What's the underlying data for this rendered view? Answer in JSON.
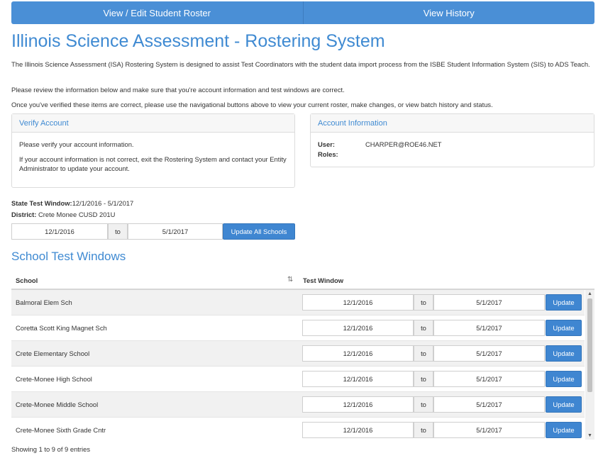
{
  "nav": {
    "roster_label": "View / Edit Student Roster",
    "history_label": "View History"
  },
  "page": {
    "title": "Illinois Science Assessment - Rostering System",
    "intro1": "The Illinois Science Assessment (ISA) Rostering System is designed to assist Test Coordinators with the student data import process from the ISBE Student Information System (SIS) to ADS Teach.",
    "intro2": "Please review the information below and make sure that you're account information and test windows are correct.",
    "intro3": "Once you've verified these items are correct, please use the navigational buttons above to view your current roster, make changes, or view batch history and status."
  },
  "verify": {
    "title": "Verify Account",
    "line1": "Please verify your account information.",
    "line2": "If your account information is not correct, exit the Rostering System and contact your Entity Administrator to update your account."
  },
  "account": {
    "title": "Account Information",
    "user_label": "User:",
    "user_value": "CHARPER@ROE46.NET",
    "roles_label": "Roles:",
    "roles_value": ""
  },
  "state_window": {
    "label": "State Test Window:",
    "value": "12/1/2016 - 5/1/2017"
  },
  "district": {
    "label": "District:",
    "value": "Crete Monee CUSD 201U"
  },
  "district_window": {
    "start": "12/1/2016",
    "to": "to",
    "end": "5/1/2017",
    "update_all_label": "Update All Schools"
  },
  "schools": {
    "section_title": "School Test Windows",
    "col_school": "School",
    "col_window": "Test Window",
    "sort_icon": "sort-arrows-icon",
    "to_label": "to",
    "update_label": "Update",
    "rows": [
      {
        "name": "Balmoral Elem Sch",
        "start": "12/1/2016",
        "end": "5/1/2017"
      },
      {
        "name": "Coretta Scott King Magnet Sch",
        "start": "12/1/2016",
        "end": "5/1/2017"
      },
      {
        "name": "Crete Elementary School",
        "start": "12/1/2016",
        "end": "5/1/2017"
      },
      {
        "name": "Crete-Monee High School",
        "start": "12/1/2016",
        "end": "5/1/2017"
      },
      {
        "name": "Crete-Monee Middle School",
        "start": "12/1/2016",
        "end": "5/1/2017"
      },
      {
        "name": "Crete-Monee Sixth Grade Cntr",
        "start": "12/1/2016",
        "end": "5/1/2017"
      }
    ],
    "footer": "Showing 1 to 9 of 9 entries"
  },
  "colors": {
    "accent": "#3f8ad2",
    "nav_bg": "#4a8fd6",
    "button_bg": "#3f86d1"
  }
}
